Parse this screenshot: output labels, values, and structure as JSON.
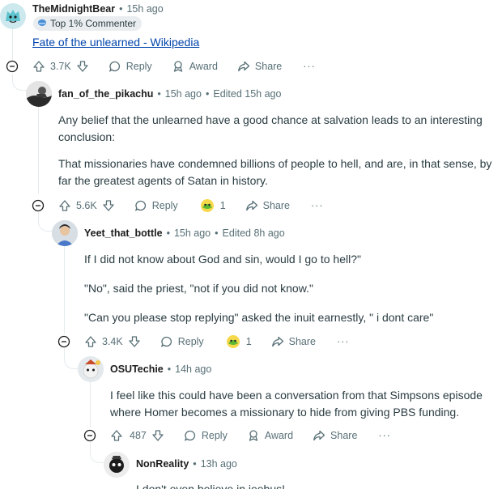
{
  "c0": {
    "author": "TheMidnightBear",
    "time": "15h ago",
    "flair": "Top 1% Commenter",
    "link_text": "Fate of the unlearned - Wikipedia",
    "votes": "3.7K",
    "reply": "Reply",
    "award": "Award",
    "share": "Share",
    "more": "···"
  },
  "c1": {
    "author": "fan_of_the_pikachu",
    "time": "15h ago",
    "edited": "Edited 15h ago",
    "paragraphs": [
      "Any belief that the unlearned have a good chance at salvation leads to an interesting conclusion:",
      "That missionaries have condemned billions of people to hell, and are, in that sense, by far the greatest agents of Satan in history."
    ],
    "votes": "5.6K",
    "reply": "Reply",
    "award_count": "1",
    "share": "Share",
    "more": "···"
  },
  "c2": {
    "author": "Yeet_that_bottle",
    "time": "15h ago",
    "edited": "Edited 8h ago",
    "paragraphs": [
      "If I did not know about God and sin, would I go to hell?\"",
      "\"No\", said the priest, \"not if you did not know.\"",
      "\"Can you please stop replying\" asked the inuit earnestly, \" i dont care\""
    ],
    "votes": "3.4K",
    "reply": "Reply",
    "award_count": "1",
    "share": "Share",
    "more": "···"
  },
  "c3": {
    "author": "OSUTechie",
    "time": "14h ago",
    "paragraphs": [
      "I feel like this could have been a conversation from that Simpsons episode where Homer becomes a missionary to hide from giving PBS funding."
    ],
    "votes": "487",
    "reply": "Reply",
    "award": "Award",
    "share": "Share",
    "more": "···"
  },
  "c4": {
    "author": "NonReality",
    "time": "13h ago",
    "paragraphs": [
      "I don't even believe in jeebus!"
    ]
  },
  "colors": {
    "link": "#0045ac",
    "meta": "#576f76",
    "text": "#2a3c42",
    "thread_line": "#e5ebee"
  }
}
